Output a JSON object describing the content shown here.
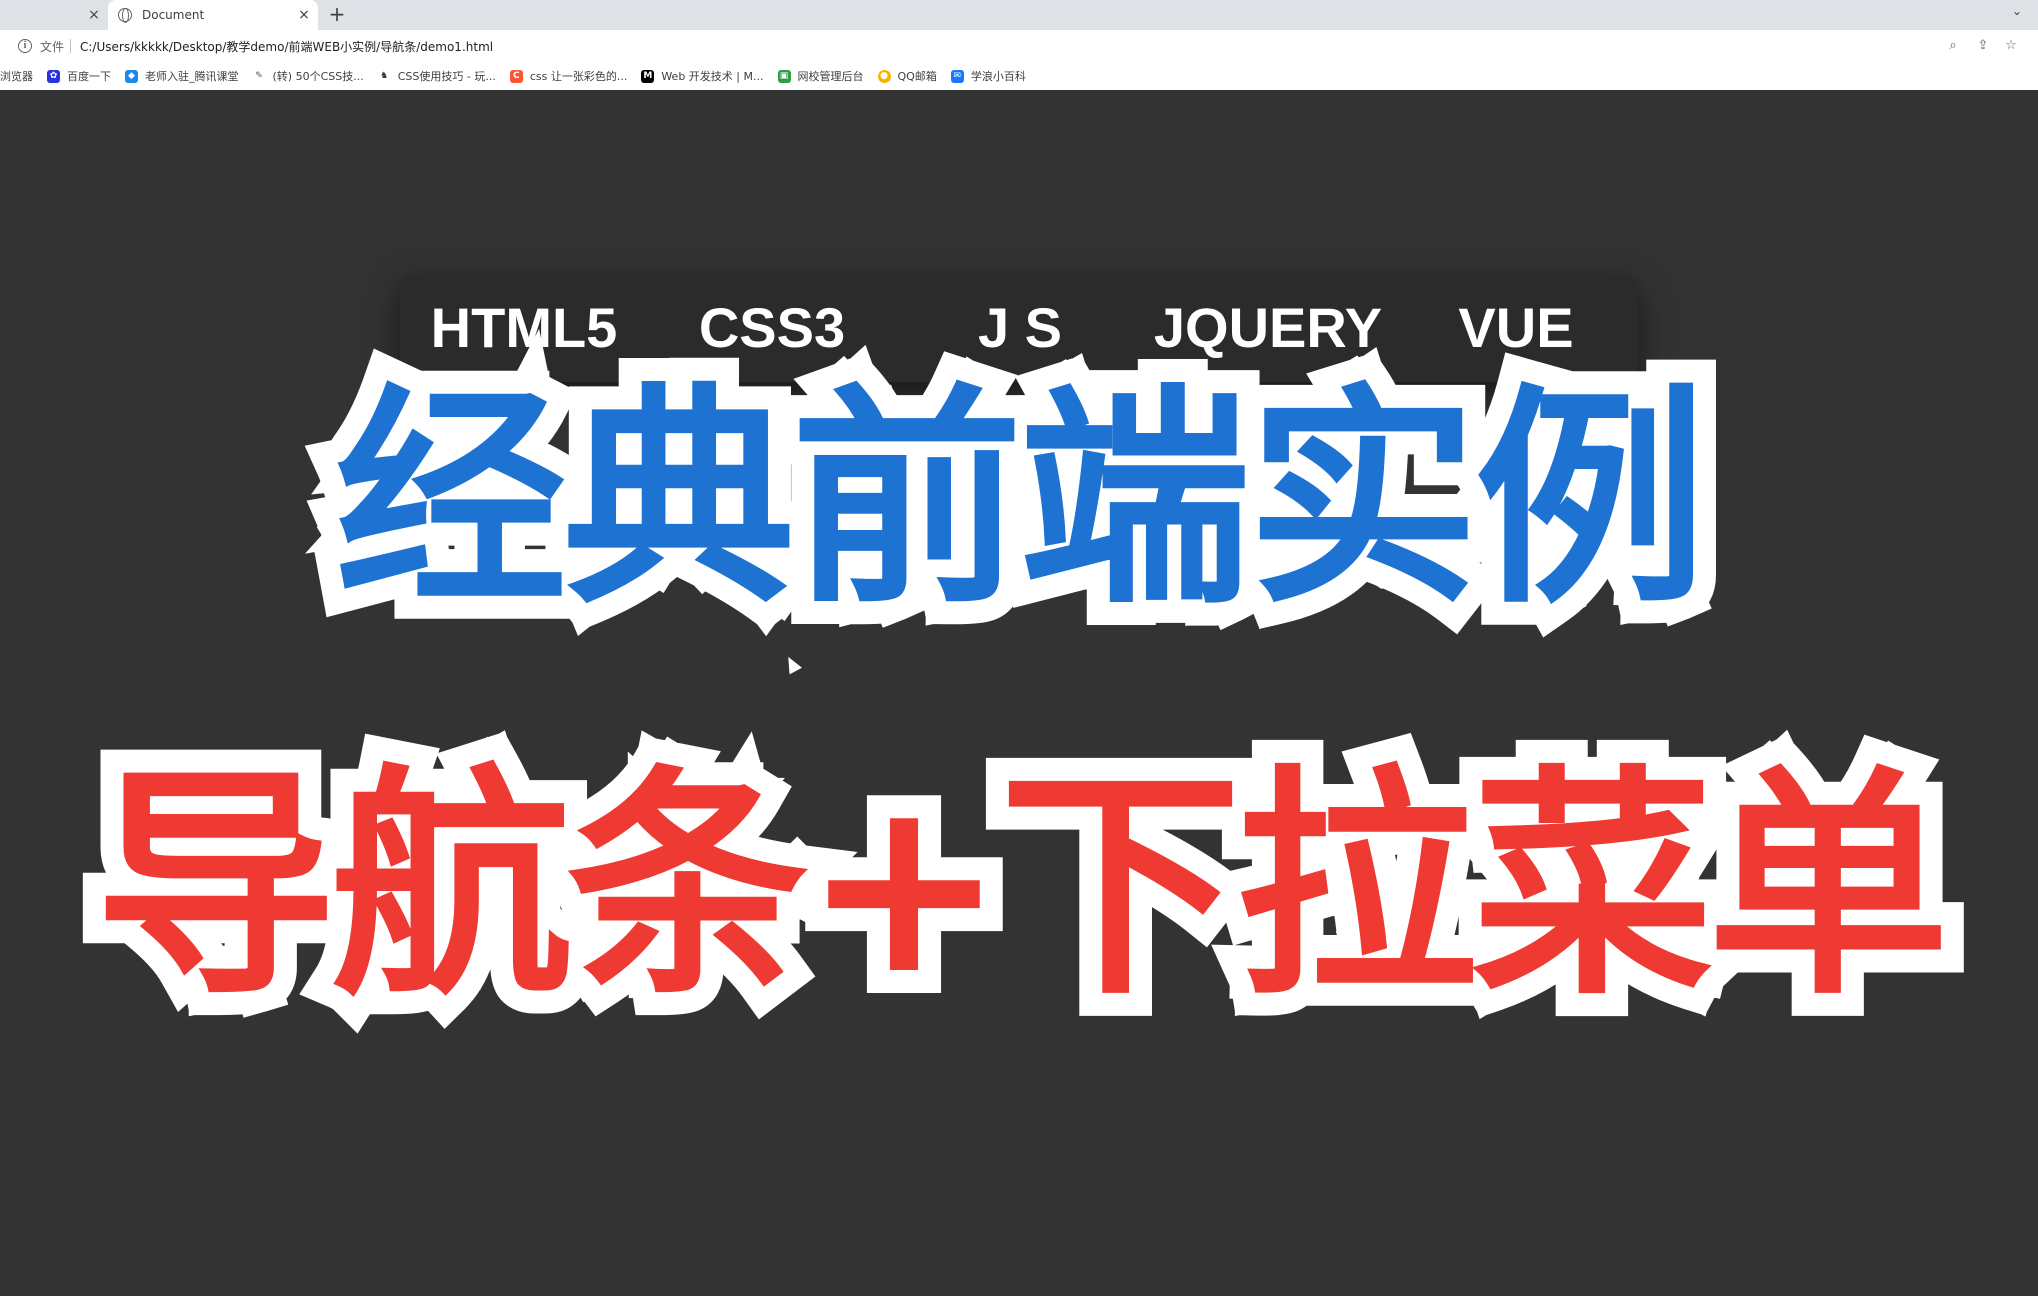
{
  "browser": {
    "active_tab_title": "Document",
    "tab_close_glyph": "×",
    "new_tab_glyph": "+",
    "tab_menu_glyph": "⌄",
    "address": {
      "file_label": "文件",
      "url": "C:/Users/kkkkk/Desktop/教学demo/前端WEB小实例/导航条/demo1.html"
    },
    "bookmarks": [
      {
        "label": "浏览器",
        "icon": "none",
        "color": ""
      },
      {
        "label": "百度一下",
        "icon": "baidu-paw-icon",
        "color": "#2932e1"
      },
      {
        "label": "老师入驻_腾讯课堂",
        "icon": "tencent-classroom-icon",
        "color": "#1e88e5"
      },
      {
        "label": "(转) 50个CSS技...",
        "icon": "quill-icon",
        "color": "#555555"
      },
      {
        "label": "CSS使用技巧 - 玩...",
        "icon": "juejin-icon",
        "color": "#333333"
      },
      {
        "label": "css 让一张彩色的...",
        "icon": "csdn-icon",
        "color": "#fc5531"
      },
      {
        "label": "Web 开发技术 | M...",
        "icon": "mdn-icon",
        "color": "#000000"
      },
      {
        "label": "网校管理后台",
        "icon": "school-admin-icon",
        "color": "#2e9e45"
      },
      {
        "label": "QQ邮箱",
        "icon": "chrome-icon",
        "color": "#f4b400"
      },
      {
        "label": "学浪小百科",
        "icon": "xuelang-icon",
        "color": "#1677ff"
      }
    ]
  },
  "nav": {
    "items": [
      "HTML5",
      "CSS3",
      "J S",
      "JQUERY",
      "VUE"
    ]
  },
  "headline": {
    "line1": "经典前端实例",
    "line2": "导航条+下拉菜单"
  },
  "colors": {
    "background": "#333333",
    "navbar": "#2b2b2b",
    "line1_fill": "#1e73d2",
    "line2_fill": "#ee3a32",
    "outline": "#ffffff"
  }
}
